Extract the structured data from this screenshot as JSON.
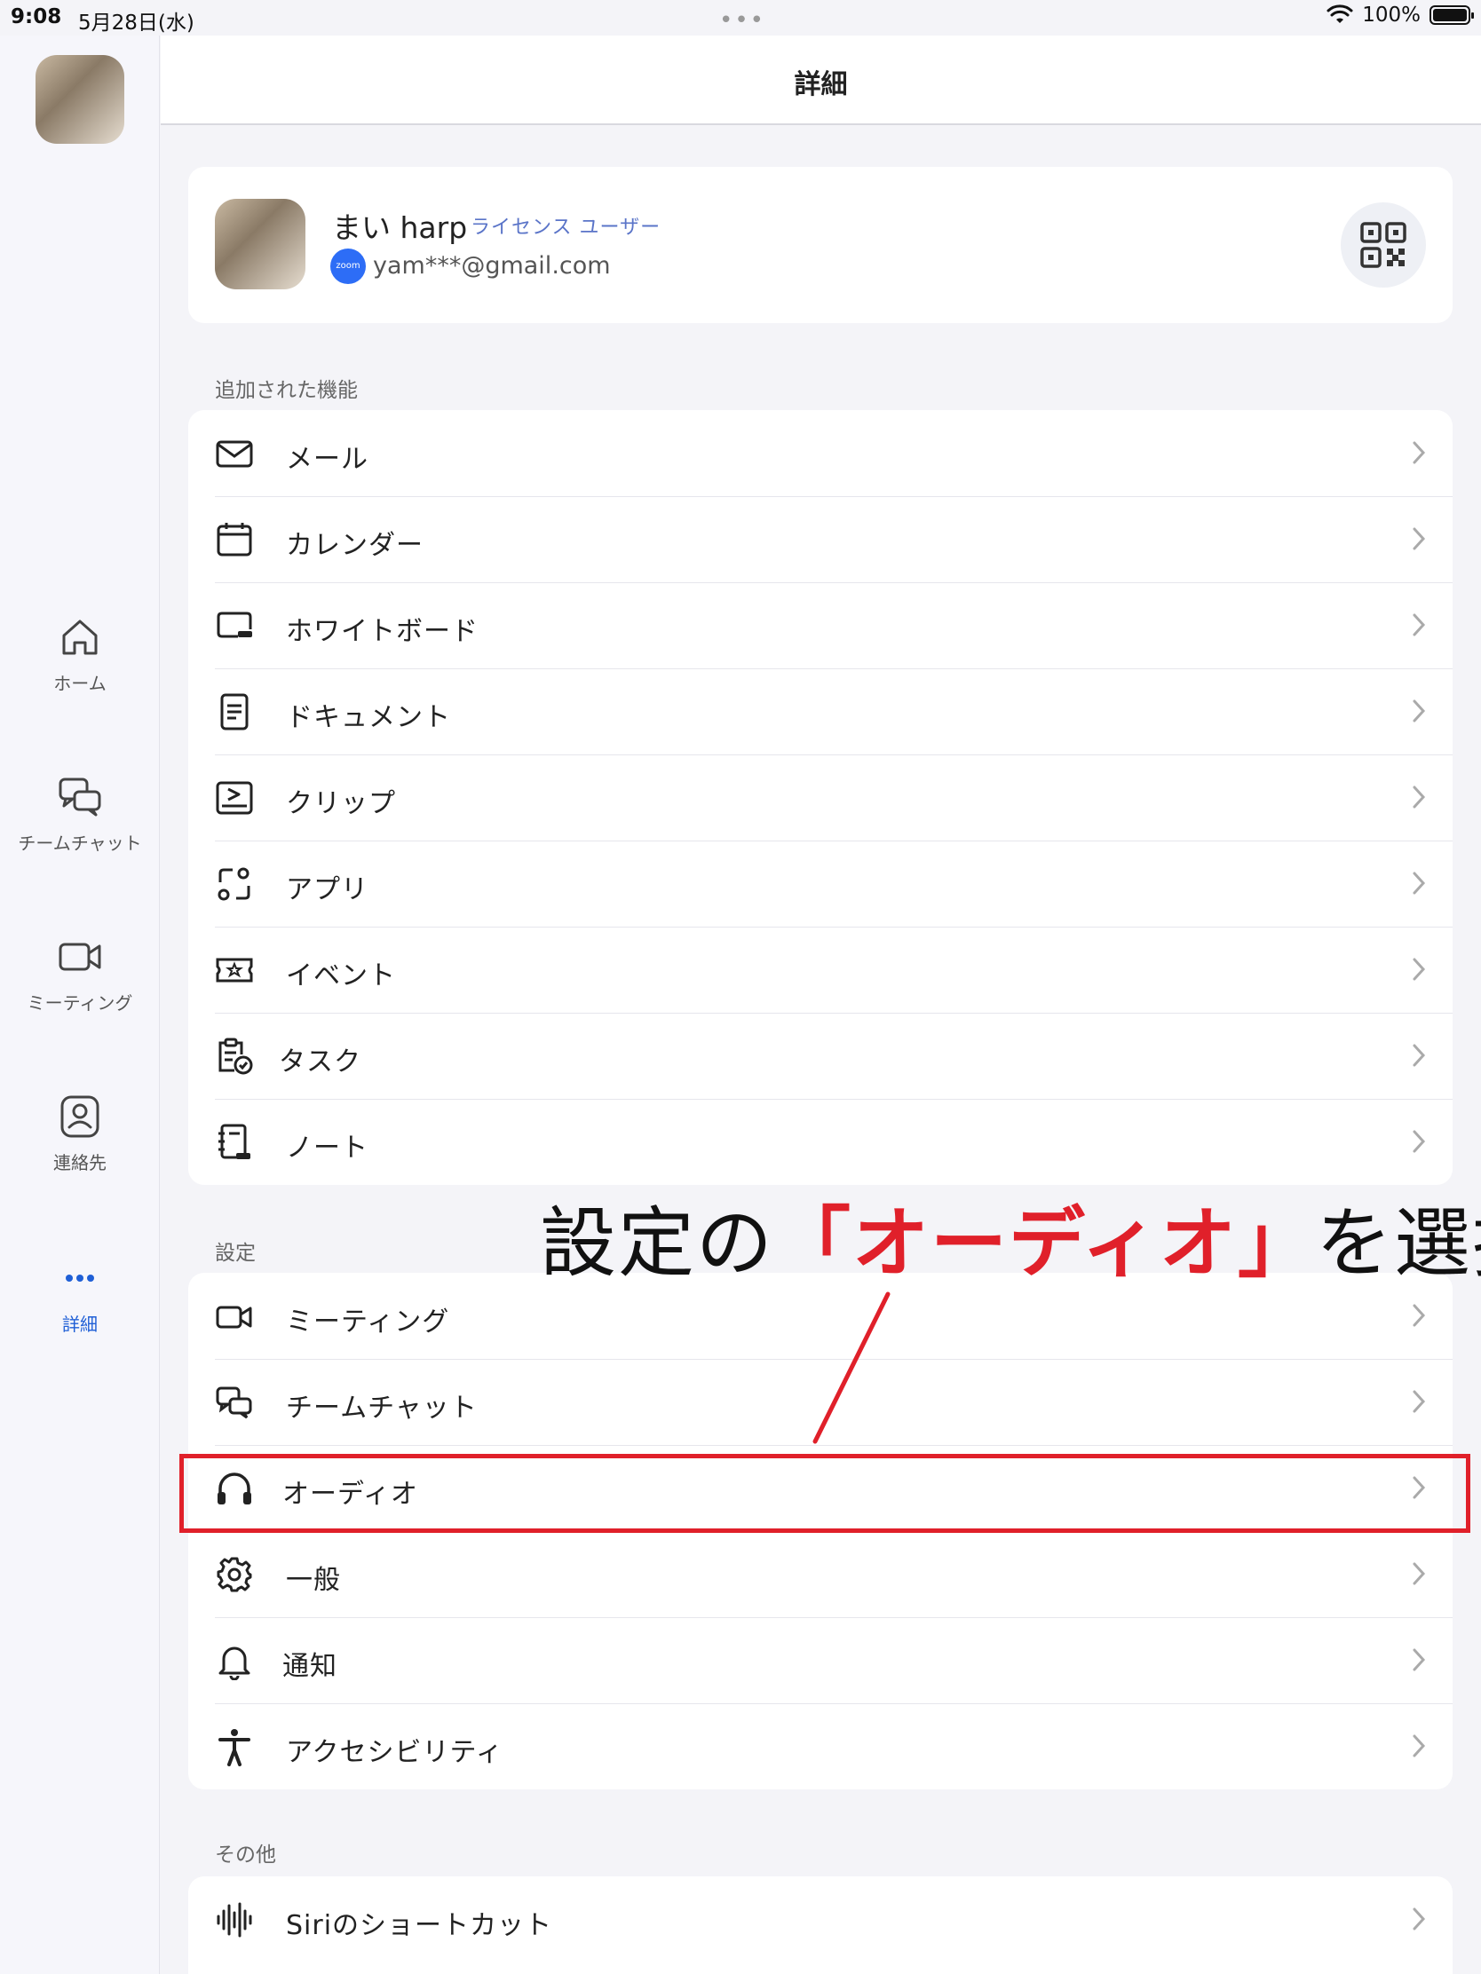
{
  "status_bar": {
    "time": "9:08",
    "date": "5月28日(水)",
    "dots": "•••",
    "battery_text": "100%",
    "battery_level": 1.0
  },
  "sidebar": {
    "items": [
      {
        "label": "ホーム",
        "icon": "home-icon"
      },
      {
        "label": "チームチャット",
        "icon": "chat-icon"
      },
      {
        "label": "ミーティング",
        "icon": "video-icon"
      },
      {
        "label": "連絡先",
        "icon": "contacts-icon"
      },
      {
        "label": "詳細",
        "icon": "more-icon",
        "active": true
      }
    ]
  },
  "header": {
    "title": "詳細"
  },
  "profile": {
    "name": "まい harp",
    "badge": "ライセンス ユーザー",
    "logo_text": "zoom",
    "email": "yam***@gmail.com"
  },
  "sections": {
    "added": {
      "label": "追加された機能",
      "items": [
        "メール",
        "カレンダー",
        "ホワイトボード",
        "ドキュメント",
        "クリップ",
        "アプリ",
        "イベント",
        "タスク",
        "ノート"
      ]
    },
    "settings": {
      "label": "設定",
      "items": [
        "ミーティング",
        "チームチャット",
        "オーディオ",
        "一般",
        "通知",
        "アクセシビリティ"
      ]
    },
    "other": {
      "label": "その他",
      "items": [
        "Siriのショートカット"
      ]
    }
  },
  "annotation": {
    "prefix": "設定の",
    "highlight": "「オーディオ」",
    "suffix": "を選択"
  },
  "colors": {
    "accent": "#1f5fd6",
    "highlight": "#e0202a",
    "badge": "#5a74c8"
  }
}
